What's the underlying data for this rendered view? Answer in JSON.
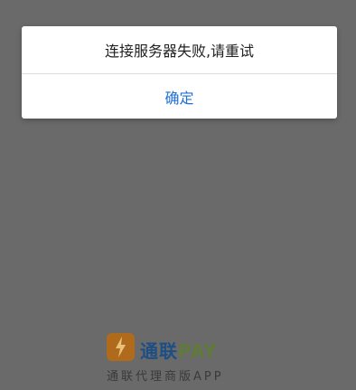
{
  "dialog": {
    "message": "连接服务器失败,请重试",
    "confirm_label": "确定",
    "confirm_color": "#1f6fd1"
  },
  "brand": {
    "logo_icon": "lightning-bolt-icon",
    "wordmark_primary": "通联",
    "wordmark_secondary": "PAY",
    "tagline": "通联代理商版APP"
  },
  "colors": {
    "overlay_background": "#6a6a6a",
    "dialog_background": "#ffffff"
  }
}
